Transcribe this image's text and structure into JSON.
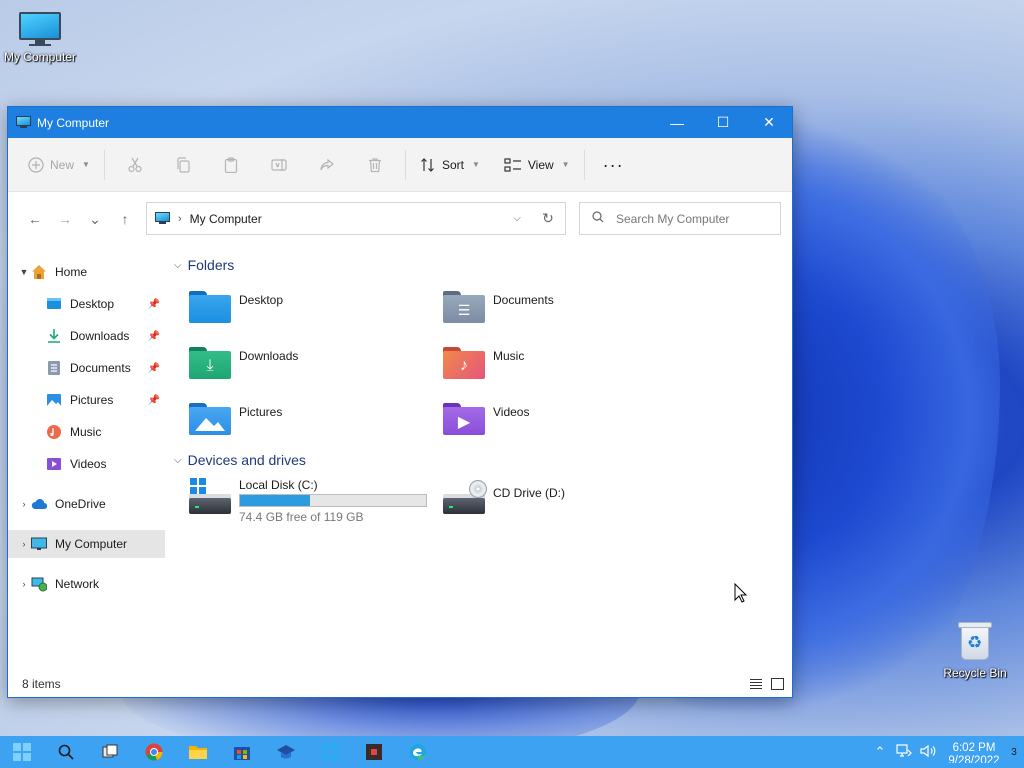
{
  "desktop": {
    "my_computer_label": "My Computer",
    "recycle_bin_label": "Recycle Bin"
  },
  "window": {
    "title": "My Computer",
    "controls": {
      "minimize": "—",
      "maximize": "☐",
      "close": "✕"
    }
  },
  "toolbar": {
    "new_label": "New",
    "sort_label": "Sort",
    "view_label": "View",
    "more_label": "···",
    "icons": [
      "cut-icon",
      "copy-icon",
      "paste-icon",
      "rename-icon",
      "share-icon",
      "delete-icon"
    ]
  },
  "navigation": {
    "back": "←",
    "forward": "→",
    "recent": "⌄",
    "up": "↑",
    "address_path": "My Computer",
    "search_placeholder": "Search My Computer"
  },
  "sidebar": {
    "items": [
      {
        "label": "Home",
        "icon": "home-icon",
        "expanded": true
      },
      {
        "label": "Desktop",
        "icon": "desktop-icon",
        "pinned": true
      },
      {
        "label": "Downloads",
        "icon": "download-icon",
        "pinned": true
      },
      {
        "label": "Documents",
        "icon": "documents-icon",
        "pinned": true
      },
      {
        "label": "Pictures",
        "icon": "pictures-icon",
        "pinned": true
      },
      {
        "label": "Music",
        "icon": "music-icon"
      },
      {
        "label": "Videos",
        "icon": "videos-icon"
      },
      {
        "label": "OneDrive",
        "icon": "onedrive-icon"
      },
      {
        "label": "My Computer",
        "icon": "computer-icon",
        "selected": true
      },
      {
        "label": "Network",
        "icon": "network-icon"
      }
    ]
  },
  "content": {
    "folders_heading": "Folders",
    "folders": [
      {
        "label": "Desktop",
        "color": "#1b8fe0"
      },
      {
        "label": "Documents",
        "color": "#7c8da3"
      },
      {
        "label": "Downloads",
        "color": "#1ea672"
      },
      {
        "label": "Music",
        "color": "#ee6a4a"
      },
      {
        "label": "Pictures",
        "color": "#2b8fe5"
      },
      {
        "label": "Videos",
        "color": "#8a4fd8"
      }
    ],
    "drives_heading": "Devices and drives",
    "drives": [
      {
        "label": "Local Disk (C:)",
        "free_text": "74.4 GB free of 119 GB",
        "used_fraction": 0.375
      },
      {
        "label": "CD Drive (D:)"
      }
    ]
  },
  "status": {
    "item_count": "8 items"
  },
  "taskbar": {
    "time": "6:02 PM",
    "date": "9/28/2022",
    "notification_count": "3"
  }
}
